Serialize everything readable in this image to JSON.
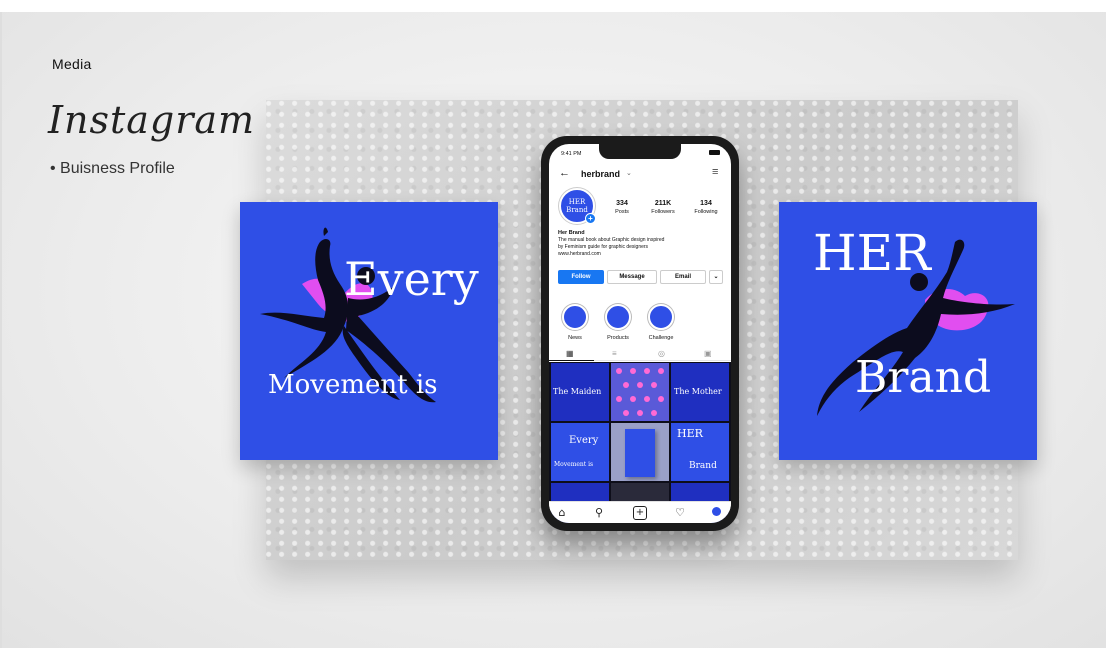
{
  "header": {
    "section": "Media",
    "title": "Instagram",
    "subtitle": "• Buisness Profile"
  },
  "cards": {
    "left": {
      "line1": "Every",
      "line2": "Movement is"
    },
    "right": {
      "line1": "HER",
      "line2": "Brand"
    }
  },
  "phone": {
    "time": "9:41 PM",
    "username": "herbrand",
    "avatar_text": "HER Brand",
    "stats": [
      {
        "value": "334",
        "label": "Posts"
      },
      {
        "value": "211K",
        "label": "Followers"
      },
      {
        "value": "134",
        "label": "Following"
      }
    ],
    "bio": {
      "name": "Her Brand",
      "line1": "The manual book about Graphic design inspired",
      "line2": "by Feminism guide for graphic designers",
      "url": "www.herbrand.com"
    },
    "buttons": {
      "follow": "Follow",
      "message": "Message",
      "email": "Email"
    },
    "highlights": [
      "News",
      "Products",
      "Challenge"
    ],
    "grid_texts": {
      "t1": "The Maiden",
      "t3": "The Mother",
      "t4a": "Every",
      "t4b": "Movement is",
      "t6a": "HER",
      "t6b": "Brand"
    }
  },
  "colors": {
    "accent": "#2f4fe6",
    "pink": "#e14ef0",
    "follow": "#1877f2"
  }
}
